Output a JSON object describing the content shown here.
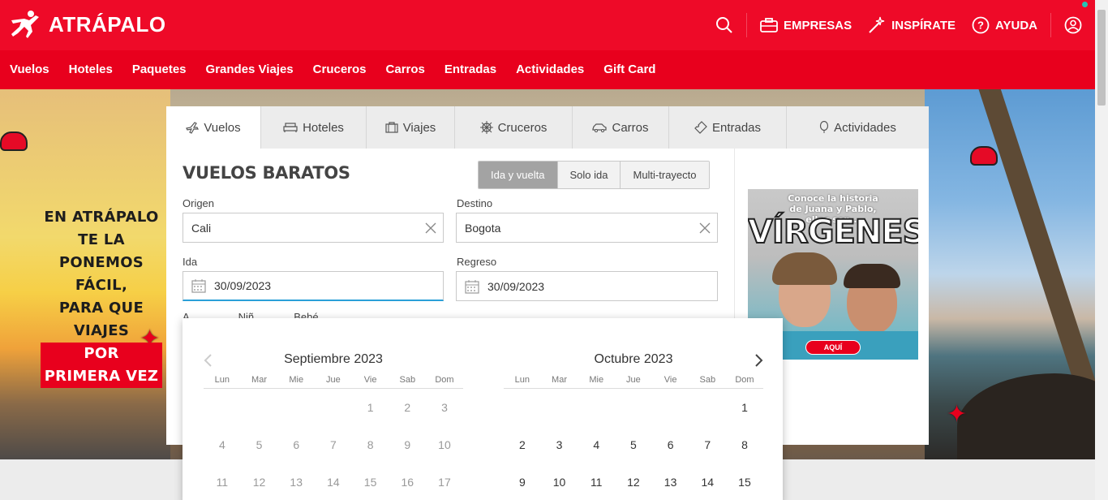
{
  "brand": {
    "name": "ATRÁPALO",
    "color": "#ee0a28"
  },
  "top_actions": {
    "search_icon": "search-icon",
    "empresas": "EMPRESAS",
    "inspirate": "INSPÍRATE",
    "ayuda": "AYUDA",
    "user_icon": "user-icon"
  },
  "nav": [
    "Vuelos",
    "Hoteles",
    "Paquetes",
    "Grandes Viajes",
    "Cruceros",
    "Carros",
    "Entradas",
    "Actividades",
    "Gift Card"
  ],
  "hero": {
    "lines": [
      "EN ATRÁPALO",
      "TE LA PONEMOS",
      "FÁCIL,",
      "PARA QUE VIAJES"
    ],
    "highlight": "POR PRIMERA VEZ"
  },
  "tabs": [
    {
      "label": "Vuelos",
      "icon": "plane-icon",
      "active": true
    },
    {
      "label": "Hoteles",
      "icon": "bed-icon"
    },
    {
      "label": "Viajes",
      "icon": "suitcase-icon"
    },
    {
      "label": "Cruceros",
      "icon": "ship-wheel-icon"
    },
    {
      "label": "Carros",
      "icon": "car-icon"
    },
    {
      "label": "Entradas",
      "icon": "ticket-icon"
    },
    {
      "label": "Actividades",
      "icon": "balloon-icon"
    }
  ],
  "form": {
    "title": "VUELOS BARATOS",
    "trip_types": [
      "Ida y vuelta",
      "Solo ida",
      "Multi-trayecto"
    ],
    "origin_label": "Origen",
    "origin_value": "Cali",
    "destination_label": "Destino",
    "destination_value": "Bogota",
    "depart_label": "Ida",
    "depart_value": "30/09/2023",
    "return_label": "Regreso",
    "return_value": "30/09/2023",
    "partial_labels": "A…             Niñ…          Bebé…"
  },
  "ad": {
    "text": "Conoce la historia\nde Juana y Pablo,\nellos son...",
    "title": "VÍRGENES",
    "button": "AQUÍ"
  },
  "calendar": {
    "left": {
      "title": "Septiembre 2023",
      "dow": [
        "Lun",
        "Mar",
        "Mie",
        "Jue",
        "Vie",
        "Sab",
        "Dom"
      ],
      "weeks": [
        [
          "",
          "",
          "",
          "",
          "1",
          "2",
          "3"
        ],
        [
          "4",
          "5",
          "6",
          "7",
          "8",
          "9",
          "10"
        ],
        [
          "11",
          "12",
          "13",
          "14",
          "15",
          "16",
          "17"
        ]
      ]
    },
    "right": {
      "title": "Octubre 2023",
      "dow": [
        "Lun",
        "Mar",
        "Mie",
        "Jue",
        "Vie",
        "Sab",
        "Dom"
      ],
      "weeks": [
        [
          "",
          "",
          "",
          "",
          "",
          "",
          "1"
        ],
        [
          "2",
          "3",
          "4",
          "5",
          "6",
          "7",
          "8"
        ],
        [
          "9",
          "10",
          "11",
          "12",
          "13",
          "14",
          "15"
        ]
      ]
    }
  }
}
